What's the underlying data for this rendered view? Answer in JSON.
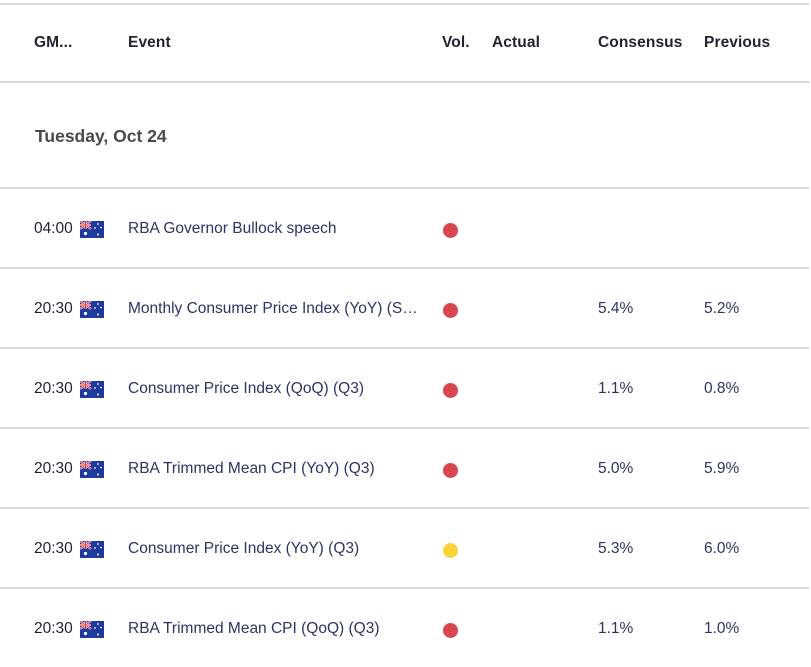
{
  "header": {
    "time": "GM...",
    "event": "Event",
    "vol": "Vol.",
    "actual": "Actual",
    "consensus": "Consensus",
    "previous": "Previous"
  },
  "date_group": "Tuesday, Oct 24",
  "colors": {
    "high_volatility": "#dc4451",
    "medium_volatility": "#fcd33a",
    "divider": "#d7dad9"
  },
  "rows": [
    {
      "time": "04:00",
      "country_flag": "australia-flag",
      "event": "RBA Governor Bullock speech",
      "volatility": "high",
      "actual": "",
      "consensus": "",
      "previous": ""
    },
    {
      "time": "20:30",
      "country_flag": "australia-flag",
      "event": "Monthly Consumer Price Index (YoY) (S…",
      "volatility": "high",
      "actual": "",
      "consensus": "5.4%",
      "previous": "5.2%"
    },
    {
      "time": "20:30",
      "country_flag": "australia-flag",
      "event": "Consumer Price Index (QoQ) (Q3)",
      "volatility": "high",
      "actual": "",
      "consensus": "1.1%",
      "previous": "0.8%"
    },
    {
      "time": "20:30",
      "country_flag": "australia-flag",
      "event": "RBA Trimmed Mean CPI (YoY) (Q3)",
      "volatility": "high",
      "actual": "",
      "consensus": "5.0%",
      "previous": "5.9%"
    },
    {
      "time": "20:30",
      "country_flag": "australia-flag",
      "event": "Consumer Price Index (YoY) (Q3)",
      "volatility": "medium",
      "actual": "",
      "consensus": "5.3%",
      "previous": "6.0%"
    },
    {
      "time": "20:30",
      "country_flag": "australia-flag",
      "event": "RBA Trimmed Mean CPI (QoQ) (Q3)",
      "volatility": "high",
      "actual": "",
      "consensus": "1.1%",
      "previous": "1.0%"
    }
  ]
}
